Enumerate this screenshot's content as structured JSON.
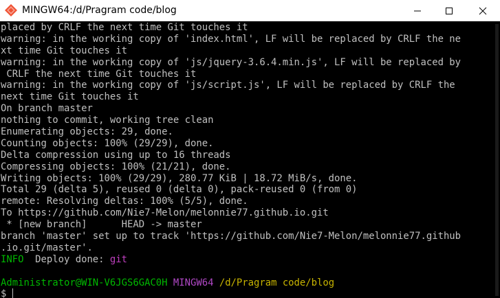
{
  "window": {
    "title": "MINGW64:/d/Pragram code/blog"
  },
  "colors": {
    "prompt_user": "#00b900",
    "prompt_env": "#b148c6",
    "prompt_path": "#c8b400",
    "info": "#00b900",
    "git": "#c040c0",
    "text": "#c0c0c0"
  },
  "terminal": {
    "lines": [
      "placed by CRLF the next time Git touches it",
      "warning: in the working copy of 'index.html', LF will be replaced by CRLF the ne",
      "xt time Git touches it",
      "warning: in the working copy of 'js/jquery-3.6.4.min.js', LF will be replaced by",
      " CRLF the next time Git touches it",
      "warning: in the working copy of 'js/script.js', LF will be replaced by CRLF the",
      "next time Git touches it",
      "On branch master",
      "nothing to commit, working tree clean",
      "Enumerating objects: 29, done.",
      "Counting objects: 100% (29/29), done.",
      "Delta compression using up to 16 threads",
      "Compressing objects: 100% (21/21), done.",
      "Writing objects: 100% (29/29), 280.77 KiB | 18.72 MiB/s, done.",
      "Total 29 (delta 5), reused 0 (delta 0), pack-reused 0 (from 0)",
      "remote: Resolving deltas: 100% (5/5), done.",
      "To https://github.com/Nie7-Melon/melonnie77.github.io.git",
      " * [new branch]      HEAD -> master",
      "branch 'master' set up to track 'https://github.com/Nie7-Melon/melonnie77.github",
      ".io.git/master'."
    ],
    "deploy": {
      "tag": "INFO",
      "message": "  Deploy done: ",
      "target": "git"
    },
    "prompt": {
      "user": "Administrator@WIN-V6JGS6GAC0H",
      "env": "MINGW64",
      "path": "/d/Pragram code/blog",
      "symbol": "$ "
    }
  }
}
